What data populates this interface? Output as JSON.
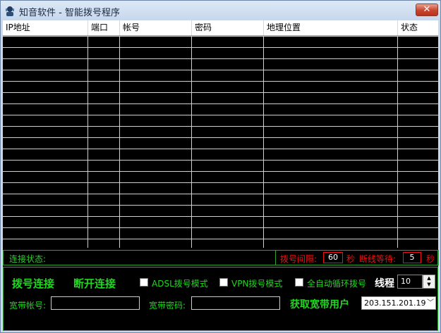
{
  "window": {
    "title": "知音软件 - 智能拨号程序",
    "close_label": "✕"
  },
  "table": {
    "columns": [
      "IP地址",
      "端口",
      "帐号",
      "密码",
      "地理位置",
      "状态"
    ]
  },
  "status": {
    "connection_label": "连接状态:",
    "interval_label": "拨号间隔:",
    "interval_value": "60",
    "seconds1": "秒",
    "wait_label": "断线等待:",
    "wait_value": "5",
    "seconds2": "秒"
  },
  "controls": {
    "dial_button": "拨号连接",
    "disconnect_button": "断开连接",
    "adsl_mode": "ADSL拨号模式",
    "vpn_mode": "VPN拨号模式",
    "auto_loop": "全自动循环拨号",
    "thread_label": "线程",
    "thread_value": "10",
    "account_label": "宽带帐号:",
    "password_label": "宽带密码:",
    "fetch_button": "获取宽带用户",
    "ip_select": "203.151.201.19"
  },
  "colors": {
    "accent_green": "#1ed81e",
    "alert_red": "#e11111",
    "background": "#000000"
  },
  "icons": {
    "app": "headset-person-icon",
    "close": "close-icon",
    "dropdown": "chevron-down-icon",
    "spin": "spin-updown-icon"
  }
}
